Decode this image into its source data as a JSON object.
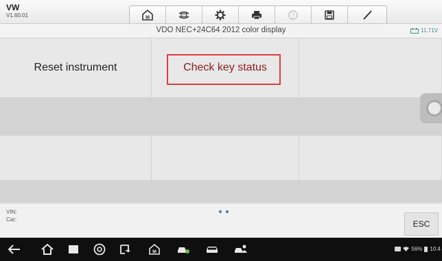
{
  "app": {
    "name": "VW",
    "version": "V1.60.01"
  },
  "toolbar": {
    "icons": [
      "home-icon",
      "vehicle-swap-icon",
      "gear-icon",
      "print-icon",
      "help-icon",
      "save-icon",
      "edit-icon"
    ]
  },
  "header": {
    "title": "VDO NEC+24C64 2012 color display",
    "voltage": "11.71V"
  },
  "grid": {
    "rows": [
      [
        "Reset instrument",
        "Check key status",
        ""
      ],
      [
        "",
        "",
        ""
      ],
      [
        "",
        "",
        ""
      ],
      [
        "",
        "",
        ""
      ]
    ],
    "highlight_color": "#e03a3a"
  },
  "footer": {
    "vin_label": "VIN:",
    "car_label": "Car:",
    "esc_label": "ESC",
    "pages": 2
  },
  "statusbar": {
    "battery": "56%",
    "time": "10:4"
  }
}
